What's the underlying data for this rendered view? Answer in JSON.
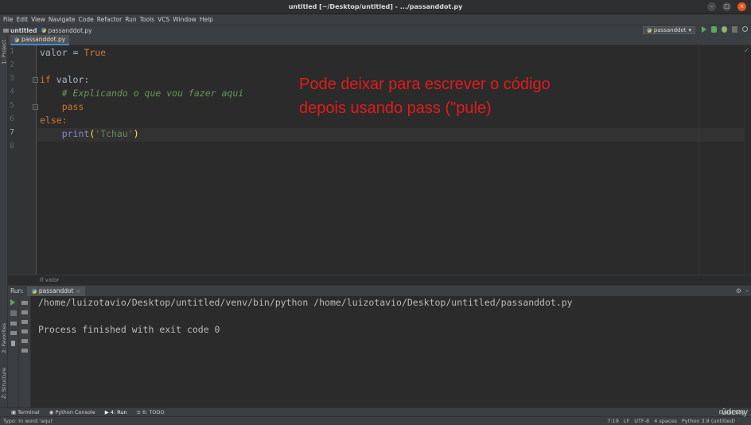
{
  "window": {
    "title": "untitled [~/Desktop/untitled] - .../passanddot.py"
  },
  "menu": [
    "File",
    "Edit",
    "View",
    "Navigate",
    "Code",
    "Refactor",
    "Run",
    "Tools",
    "VCS",
    "Window",
    "Help"
  ],
  "breadcrumbs": {
    "project": "untitled",
    "file": "passanddot.py"
  },
  "run_config": {
    "label": "passanddot"
  },
  "left_tabs": {
    "project": "1: Project",
    "favorites": "2: Favorites",
    "structure": "Z: Structure"
  },
  "editor": {
    "tab_label": "passanddot.py",
    "line_numbers": [
      "1",
      "2",
      "3",
      "4",
      "5",
      "6",
      "7",
      "8"
    ],
    "code": {
      "l1_var": "valor",
      "l1_op": " = ",
      "l1_val": "True",
      "l3_kw": "if",
      "l3_rest": " valor:",
      "l4_comment": "    # Explicando o que vou fazer aqui",
      "l5_kw": "    pass",
      "l6_kw": "else:",
      "l7_indent": "    ",
      "l7_fn": "print",
      "l7_open": "(",
      "l7_str": "'Tchau'",
      "l7_close": ")"
    },
    "annotation_line1": "Pode deixar para escrever o código",
    "annotation_line2": "depois usando pass (\"pule)",
    "context_breadcrumb": "if valor"
  },
  "run_panel": {
    "label": "Run:",
    "tab": "passanddot",
    "output": [
      "/home/luizotavio/Desktop/untitled/venv/bin/python /home/luizotavio/Desktop/untitled/passanddot.py",
      "",
      "Process finished with exit code 0"
    ]
  },
  "bottom_tabs": [
    "Terminal",
    "Python Console",
    "4: Run",
    "6: TODO"
  ],
  "event_log": "Event Log",
  "status": {
    "message": "Typo: In word 'aqui'",
    "position": "7:19",
    "line_sep": "LF",
    "encoding": "UTF-8",
    "indent": "4 spaces",
    "interpreter": "Python 3.8 (untitled)"
  },
  "watermark": "ûdemy",
  "colors": {
    "accent": "#4a88c7",
    "annotation": "#e31b1b",
    "keyword": "#cc7832",
    "string": "#6a8759",
    "comment": "#629755"
  }
}
